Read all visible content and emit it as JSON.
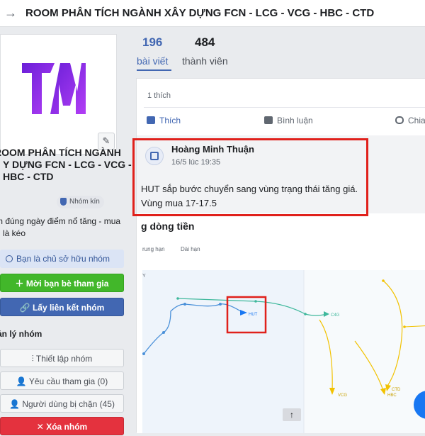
{
  "header": {
    "title": "ROOM PHÂN TÍCH NGÀNH XÂY DỰNG FCN - LCG - VCG - HBC - CTD"
  },
  "group": {
    "name_line1": "ROOM PHÂN TÍCH NGÀNH",
    "name_line2": "Y DỰNG FCN - LCG - VCG -",
    "name_line3": "HBC - CTD",
    "privacy_badge": "Nhóm kín",
    "desc_line1": "m đúng ngày điểm nổ tăng - mua",
    "desc_line2": "g là kéo",
    "owner_notice": "Bạn là chủ sở hữu nhóm",
    "invite_button": "Mời bạn bè tham gia",
    "link_button": "Lấy liên kết nhóm",
    "management_heading": "ản lý nhóm",
    "settings_button": "Thiết lập nhóm",
    "requests_button": "Yêu cầu tham gia (0)",
    "blocked_button": "Người dùng bị chặn (45)",
    "delete_button": "Xóa nhóm"
  },
  "stats": {
    "posts_count": "196",
    "posts_label": "bài viết",
    "members_count": "484",
    "members_label": "thành viên"
  },
  "post": {
    "likes_text": "1 thích",
    "like_action": "Thích",
    "comment_action": "Bình luận",
    "share_action": "Chia",
    "comment": {
      "author": "Hoàng Minh Thuận",
      "time": "16/5 lúc 19:35",
      "text_line1": "HUT sắp bước chuyển sang vùng trạng thái tăng giá.",
      "text_line2": "Vùng mua 17-17.5"
    },
    "chart": {
      "title": "g dòng tiền",
      "tab_short": "rung hạn",
      "tab_long": "Dài hạn",
      "corner_label": "Y",
      "labels": [
        "HUT",
        "C4G",
        "VCG",
        "CTD",
        "HBC"
      ]
    }
  },
  "colors": {
    "accent": "#4267b2",
    "highlight": "#e0201b",
    "green": "#42b72a",
    "red": "#e4323e",
    "logo_purple": "#8a2be2"
  },
  "icons": {
    "back": "arrow-left-icon",
    "edit": "pencil-icon",
    "scroll_top": "arrow-up-icon"
  }
}
